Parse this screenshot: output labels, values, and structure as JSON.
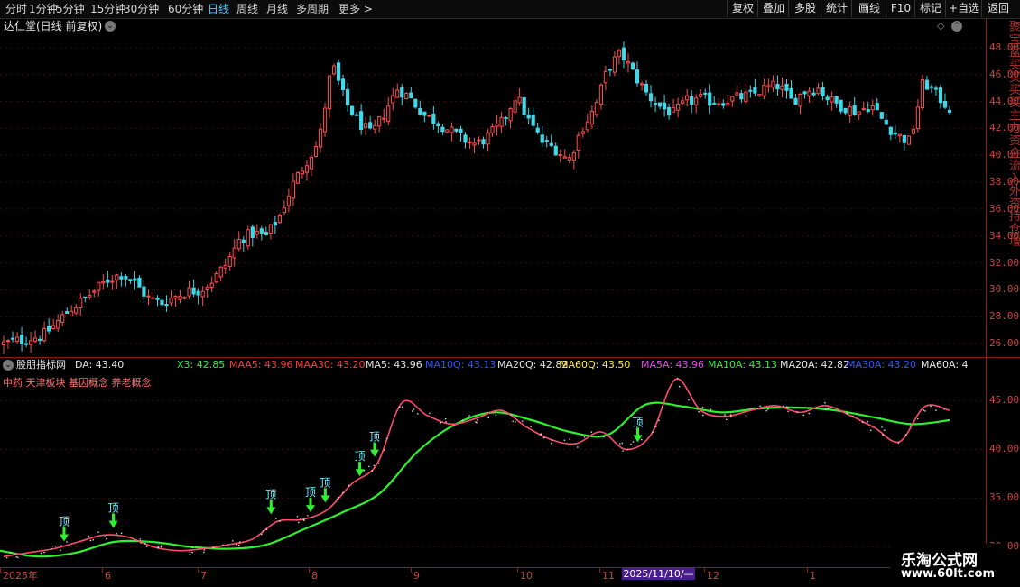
{
  "toolbar": {
    "left": [
      "分时",
      "1分钟",
      "5分钟",
      "15分钟",
      "30分钟",
      "60分钟",
      "日线",
      "周线",
      "月线",
      "多周期",
      "更多 >"
    ],
    "active_index": 6,
    "right": [
      "复权",
      "叠加",
      "多股",
      "统计",
      "画线",
      "F10",
      "标记",
      "+自选",
      "返回"
    ]
  },
  "header": {
    "stock_title": "达仁堂(日线 前复权)"
  },
  "indicator": {
    "name": "股朋指标网",
    "values": [
      {
        "text": "DA: 43.40",
        "color": "#e6e6e6"
      },
      {
        "text": "X3: 42.85",
        "color": "#33ee44"
      },
      {
        "text": "MAA5: 43.96",
        "color": "#ff3b3b"
      },
      {
        "text": "MAA30: 43.20",
        "color": "#ff3b3b"
      },
      {
        "text": "MA5: 43.96",
        "color": "#e6e6e6"
      },
      {
        "text": "MA10Q: 43.13",
        "color": "#3355ff"
      },
      {
        "text": "MA20Q: 42.82",
        "color": "#e6e6e6"
      },
      {
        "text": "MA60Q: 43.50",
        "color": "#ffee33"
      },
      {
        "text": "MA5A: 43.96",
        "color": "#ee44ee"
      },
      {
        "text": "MA10A: 43.13",
        "color": "#33ee44"
      },
      {
        "text": "MA20A: 42.82",
        "color": "#e6e6e6"
      },
      {
        "text": "MA30A: 43.20",
        "color": "#3355ff"
      },
      {
        "text": "MA60A: 4",
        "color": "#e6e6e6"
      }
    ],
    "concepts": "中药 天津板块 基因概念 养老概念",
    "signal_label": "顶"
  },
  "price_axis": {
    "ticks": [
      "48.00",
      "46.00",
      "44.00",
      "42.00",
      "40.00",
      "38.00",
      "36.00",
      "34.00",
      "32.00",
      "30.00",
      "28.00",
      "26.00"
    ]
  },
  "ind_axis": {
    "ticks": [
      "45.00",
      "40.00",
      "35.00",
      "30.00"
    ]
  },
  "date_axis": {
    "labels": [
      "2025年",
      "6",
      "7",
      "8",
      "9",
      "10",
      "11",
      "12",
      "1"
    ],
    "cursor_date": "2025/11/10/—"
  },
  "right_vertical": "聚宝盆买买买买主力资金流入外资持仓增",
  "watermark": {
    "line1": "乐淘公式网",
    "line2": "www.60lt.com"
  },
  "chart_data": {
    "type": "candlestick",
    "title": "达仁堂(日线 前复权)",
    "xlabel": "",
    "ylabel": "",
    "ylim": [
      25,
      49
    ],
    "months": [
      "2025年",
      "6",
      "7",
      "8",
      "9",
      "10",
      "11",
      "12",
      "1"
    ],
    "up_color": "#ff4d4d",
    "down_color": "#3fd8e8",
    "close_path": [
      26.0,
      26.2,
      26.4,
      26.6,
      27.5,
      28.5,
      29.2,
      30.0,
      30.8,
      31.2,
      30.5,
      29.4,
      29.0,
      29.5,
      29.9,
      30.0,
      30.8,
      32.0,
      33.8,
      34.2,
      34.0,
      35.5,
      37.8,
      39.5,
      41.0,
      46.8,
      44.0,
      42.5,
      41.5,
      43.2,
      45.0,
      44.2,
      43.0,
      42.5,
      41.8,
      41.2,
      40.8,
      41.5,
      42.5,
      44.5,
      42.5,
      41.0,
      40.5,
      39.6,
      42.0,
      43.5,
      46.5,
      47.6,
      46.0,
      44.5,
      43.6,
      43.1,
      44.0,
      44.2,
      44.0,
      44.1,
      44.3,
      44.5,
      45.0,
      45.2,
      44.0,
      44.8,
      45.0,
      44.0,
      43.6,
      43.2,
      43.8,
      42.5,
      41.5,
      41.0,
      45.5,
      44.5,
      43.5
    ],
    "indicator_ylim": [
      28,
      48
    ],
    "pink_line": [
      29.0,
      29.4,
      29.8,
      30.5,
      31.2,
      31.0,
      30.0,
      29.6,
      29.8,
      30.2,
      30.8,
      32.6,
      32.8,
      33.8,
      36.5,
      38.5,
      44.8,
      43.5,
      42.6,
      43.2,
      44.0,
      42.3,
      41.0,
      40.6,
      41.8,
      40.0,
      41.5,
      47.2,
      44.0,
      43.4,
      44.0,
      44.5,
      43.8,
      44.5,
      43.5,
      42.2,
      40.8,
      44.4,
      44.0
    ],
    "green_line": [
      29.6,
      29.0,
      29.4,
      30.5,
      30.5,
      30.0,
      29.8,
      30.2,
      31.8,
      33.5,
      35.5,
      39.8,
      42.6,
      43.8,
      43.0,
      41.8,
      41.5,
      44.6,
      44.4,
      43.8,
      44.2,
      44.3,
      44.0,
      43.3,
      42.6,
      43.0
    ],
    "signals": [
      {
        "label": "顶",
        "x_frac": 0.065
      },
      {
        "label": "顶",
        "x_frac": 0.115
      },
      {
        "label": "顶",
        "x_frac": 0.275
      },
      {
        "label": "顶",
        "x_frac": 0.315
      },
      {
        "label": "顶",
        "x_frac": 0.33
      },
      {
        "label": "顶",
        "x_frac": 0.365
      },
      {
        "label": "顶",
        "x_frac": 0.38
      },
      {
        "label": "顶",
        "x_frac": 0.647
      }
    ]
  }
}
